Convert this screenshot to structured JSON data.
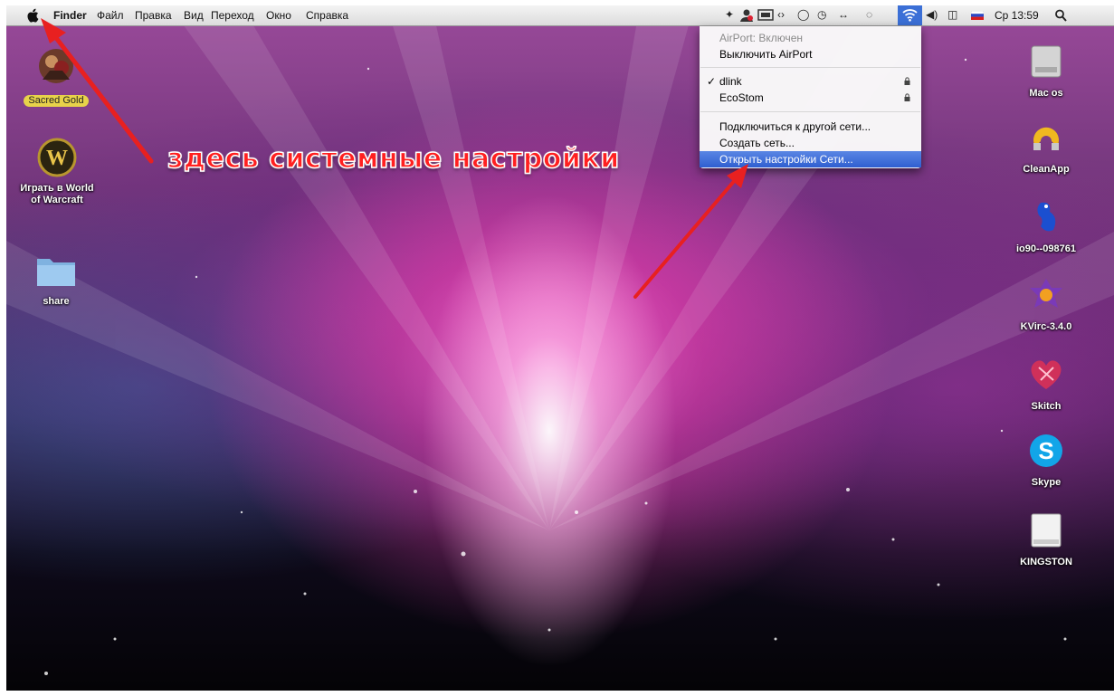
{
  "menubar": {
    "app_name": "Finder",
    "menus": [
      "Файл",
      "Правка",
      "Вид",
      "Переход",
      "Окно",
      "Справка"
    ],
    "clock": "Ср 13:59",
    "language": "RU"
  },
  "airport_menu": {
    "status": "AirPort: Включен",
    "toggle": "Выключить AirPort",
    "networks": [
      {
        "name": "dlink",
        "checked": true,
        "locked": true
      },
      {
        "name": "EcoStom",
        "checked": false,
        "locked": true
      }
    ],
    "check_mark": "✓",
    "join_other": "Подключиться к другой сети...",
    "create_network": "Создать сеть...",
    "open_prefs": "Открыть настройки Сети..."
  },
  "annotation": "здесь системные настройки",
  "desktop_icons_left": [
    {
      "label": "Sacred Gold",
      "icon": "sacred-gold-icon"
    },
    {
      "label": "Играть в World of Warcraft",
      "icon": "world-of-warcraft-icon"
    },
    {
      "label": "share",
      "icon": "folder-icon"
    }
  ],
  "desktop_icons_right": [
    {
      "label": "Mac os",
      "icon": "hard-drive-icon"
    },
    {
      "label": "CleanApp",
      "icon": "cleanapp-icon"
    },
    {
      "label": "io90--098761",
      "icon": "blue-frog-icon"
    },
    {
      "label": "KVirc-3.4.0",
      "icon": "kvirc-icon"
    },
    {
      "label": "Skitch",
      "icon": "skitch-icon"
    },
    {
      "label": "Skype",
      "icon": "skype-icon"
    },
    {
      "label": "KINGSTON",
      "icon": "usb-drive-icon"
    }
  ],
  "colors": {
    "highlight": "#3b6fd6",
    "annotation": "#ff2020"
  }
}
